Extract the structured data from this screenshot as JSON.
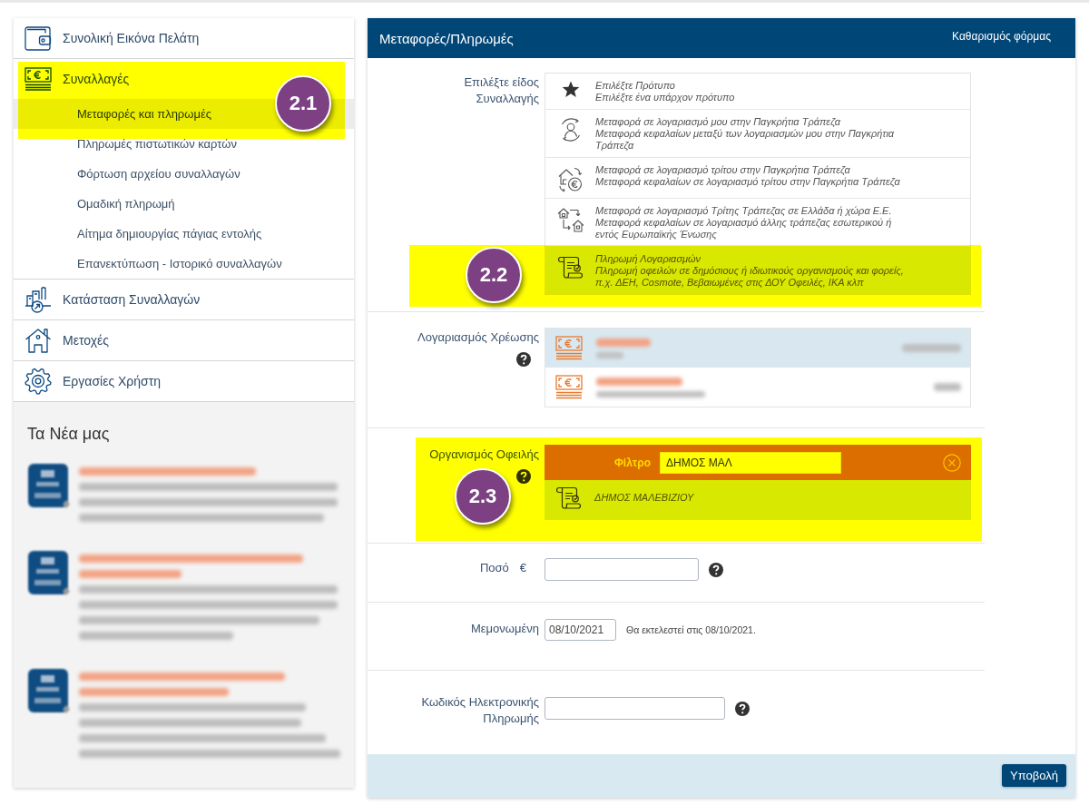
{
  "sidebar": {
    "menu": [
      {
        "label": "Συνολική Εικόνα Πελάτη"
      },
      {
        "label": "Συναλλαγές",
        "callout": "2.1",
        "children": [
          {
            "label": "Μεταφορές και πληρωμές",
            "selected": true
          },
          {
            "label": "Πληρωμές πιστωτικών καρτών",
            "selected": false
          },
          {
            "label": "Φόρτωση αρχείου συναλλαγών",
            "selected": false
          },
          {
            "label": "Ομαδική πληρωμή",
            "selected": false
          },
          {
            "label": "Αίτημα δημιουργίας πάγιας εντολής",
            "selected": false
          },
          {
            "label": "Επανεκτύπωση - Ιστορικό συναλλαγών",
            "selected": false
          }
        ]
      },
      {
        "label": "Κατάσταση Συναλλαγών"
      },
      {
        "label": "Μετοχές"
      },
      {
        "label": "Εργασίες Χρήστη"
      }
    ],
    "news": {
      "title": "Τα Νέα μας",
      "items": [
        {
          "blurred": true
        },
        {
          "blurred": true
        },
        {
          "blurred": true
        }
      ]
    }
  },
  "form": {
    "title": "Μεταφορές/Πληρωμές",
    "clear_link": "Καθαρισμός φόρμας",
    "rows": [
      {
        "kind": "options",
        "label": "Επιλέξτε είδος Συναλλαγής",
        "help": false,
        "options": [
          {
            "title": "Επιλέξτε Πρότυπο",
            "description": "Επιλέξτε ένα υπάρχον πρότυπο",
            "selected": false
          },
          {
            "title": "Μεταφορά σε λογαριασμό μου στην Παγκρήτια Τράπεζα",
            "description": "Μεταφορά κεφαλαίων μεταξύ των λογαριασμών μου στην Παγκρήτια Τράπεζα",
            "selected": false
          },
          {
            "title": "Μεταφορά σε λογαριασμό τρίτου στην Παγκρήτια Τράπεζα",
            "description": "Μεταφορά κεφαλαίων σε λογαριασμό τρίτου στην Παγκρήτια Τράπεζα",
            "selected": false
          },
          {
            "title": "Μεταφορά σε λογαριασμό Τρίτης Τράπεζας σε Ελλάδα ή χώρα Ε.Ε.",
            "description": "Μεταφορά κεφαλαίων σε λογαριασμό άλλης τράπεζας εσωτερικού ή εντός Ευρωπαϊκής Ένωσης",
            "selected": false
          },
          {
            "title": "Πληρωμή Λογαριασμών",
            "description": "Πληρωμή οφειλών σε δημόσιους ή ιδιωτικούς οργανισμούς και φορείς, π.χ. ΔΕΗ, Cosmote, Βεβαιωμένες στις ΔΟΥ Οφειλές, ΙΚΑ κλπ",
            "selected": true,
            "callout": "2.2"
          }
        ]
      },
      {
        "kind": "accounts",
        "label": "Λογαριασμός Χρέωσης",
        "help": true,
        "accounts": [
          {
            "blurred": true,
            "selected": true
          },
          {
            "blurred": true,
            "selected": false
          }
        ]
      },
      {
        "kind": "filter",
        "label": "Οργανισμός Οφειλής",
        "help": true,
        "callout": "2.3",
        "filter": {
          "label": "Φίλτρο",
          "value": "ΔΗΜΟΣ ΜΑΛ"
        },
        "results": [
          {
            "name": "ΔΗΜΟΣ ΜΑΛΕΒΙΖΙΟΥ",
            "selected": true
          }
        ]
      },
      {
        "kind": "amount",
        "label": "Ποσό",
        "currency": "€",
        "help": true
      },
      {
        "kind": "date",
        "label": "Μεμονωμένη",
        "help": false,
        "value": "08/10/2021",
        "note": "Θα εκτελεστεί στις 08/10/2021."
      },
      {
        "kind": "text",
        "label": "Κωδικός Ηλεκτρονικής Πληρωμής",
        "help": true
      }
    ],
    "submit": "Υποβολή"
  }
}
